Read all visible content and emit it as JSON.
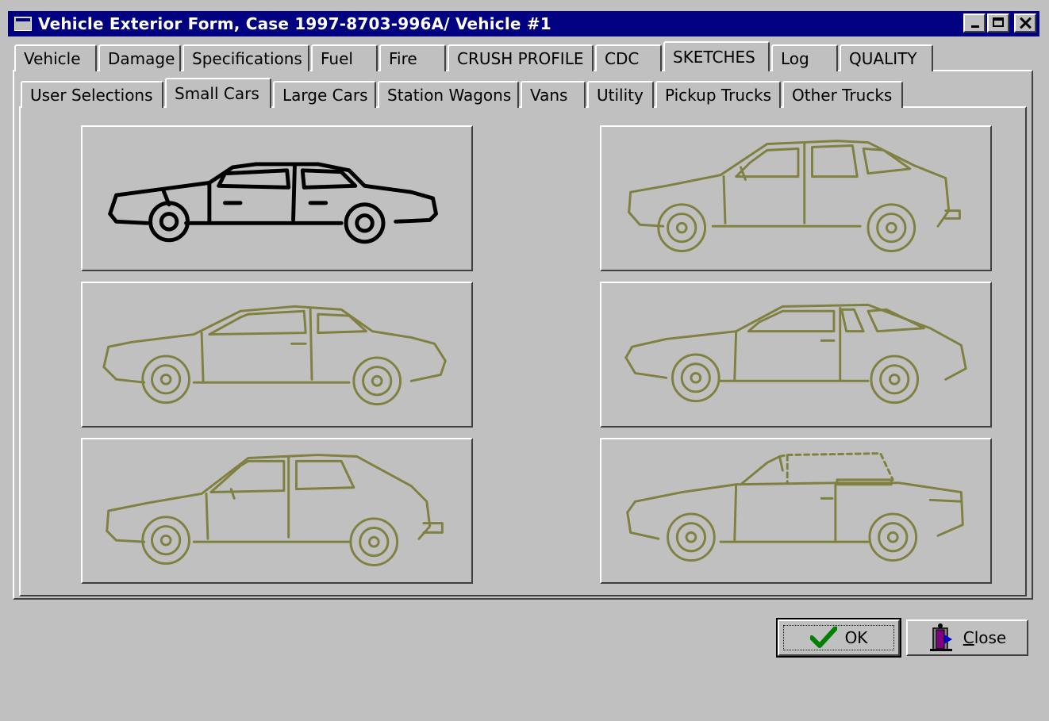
{
  "window": {
    "title": "Vehicle Exterior Form, Case 1997-8703-996A/ Vehicle #1"
  },
  "main_tabs": [
    {
      "label": "Vehicle"
    },
    {
      "label": "Damage"
    },
    {
      "label": "Specifications"
    },
    {
      "label": "Fuel"
    },
    {
      "label": "Fire"
    },
    {
      "label": "CRUSH PROFILE"
    },
    {
      "label": "CDC"
    },
    {
      "label": "SKETCHES",
      "active": true
    },
    {
      "label": "Log"
    },
    {
      "label": "QUALITY"
    }
  ],
  "sub_tabs": [
    {
      "label": "User Selections"
    },
    {
      "label": "Small Cars",
      "active": true
    },
    {
      "label": "Large Cars"
    },
    {
      "label": "Station Wagons"
    },
    {
      "label": "Vans"
    },
    {
      "label": "Utility"
    },
    {
      "label": "Pickup Trucks"
    },
    {
      "label": "Other Trucks"
    }
  ],
  "sketches": {
    "selected_color": "#000000",
    "default_color": "#808040",
    "items": [
      {
        "icon": "sedan-sketch",
        "selected": true
      },
      {
        "icon": "hatchback-4door-sketch",
        "selected": false
      },
      {
        "icon": "coupe-sketch",
        "selected": false
      },
      {
        "icon": "sport-hatchback-sketch",
        "selected": false
      },
      {
        "icon": "hatchback-2door-sketch",
        "selected": false
      },
      {
        "icon": "convertible-sketch",
        "selected": false
      }
    ]
  },
  "buttons": {
    "ok_label": "OK",
    "close_label": "Close"
  },
  "colors": {
    "titlebar": "#000080",
    "face": "#c0c0c0",
    "ok_check": "#008000"
  }
}
